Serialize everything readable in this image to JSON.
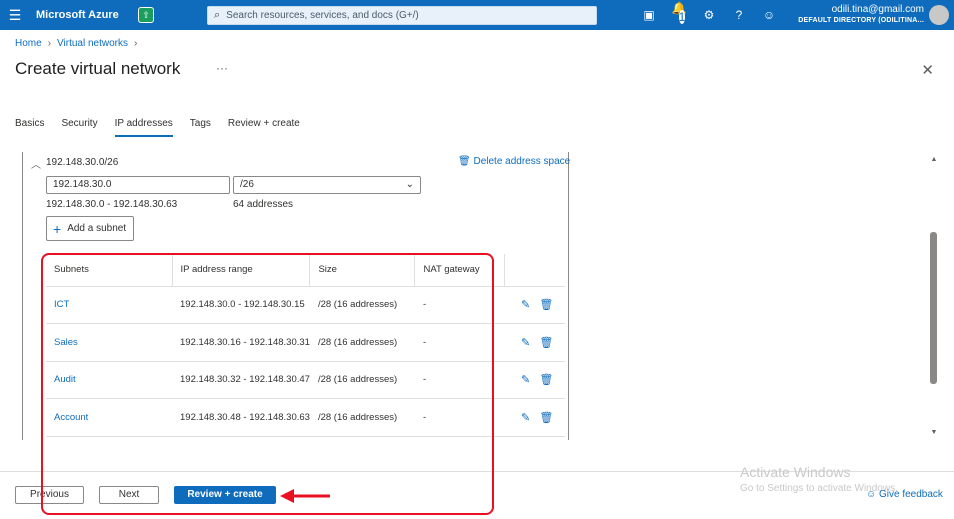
{
  "topbar": {
    "menu_icon": "hamburger-icon",
    "brand": "Microsoft Azure",
    "search_placeholder": "Search resources, services, and docs (G+/)",
    "notification_count": "1",
    "account_email": "odili.tina@gmail.com",
    "account_directory": "DEFAULT DIRECTORY (ODILITINA..."
  },
  "breadcrumb": {
    "home": "Home",
    "virtual_networks": "Virtual networks"
  },
  "page": {
    "title": "Create virtual network",
    "more": "···"
  },
  "tabs": [
    "Basics",
    "Security",
    "IP addresses",
    "Tags",
    "Review + create"
  ],
  "address_space": {
    "title": "192.148.30.0/26",
    "delete_label": "Delete address space",
    "address_value": "192.148.30.0",
    "prefix_value": "/26",
    "range": "192.148.30.0 - 192.148.30.63",
    "count": "64 addresses",
    "add_subnet_label": "Add a subnet"
  },
  "subnet_table": {
    "headers": [
      "Subnets",
      "IP address range",
      "Size",
      "NAT gateway"
    ],
    "rows": [
      {
        "name": "ICT",
        "range": "192.148.30.0 - 192.148.30.15",
        "size": "/28 (16 addresses)",
        "nat": "-"
      },
      {
        "name": "Sales",
        "range": "192.148.30.16 - 192.148.30.31",
        "size": "/28 (16 addresses)",
        "nat": "-"
      },
      {
        "name": "Audit",
        "range": "192.148.30.32 - 192.148.30.47",
        "size": "/28 (16 addresses)",
        "nat": "-"
      },
      {
        "name": "Account",
        "range": "192.148.30.48 - 192.148.30.63",
        "size": "/28 (16 addresses)",
        "nat": "-"
      }
    ]
  },
  "footer": {
    "previous": "Previous",
    "next": "Next",
    "review_create": "Review + create",
    "feedback": "Give feedback"
  },
  "watermark": {
    "line1": "Activate Windows",
    "line2": "Go to Settings to activate Windows."
  },
  "colors": {
    "accent": "#0f6cbd",
    "annotation": "#e81123"
  }
}
